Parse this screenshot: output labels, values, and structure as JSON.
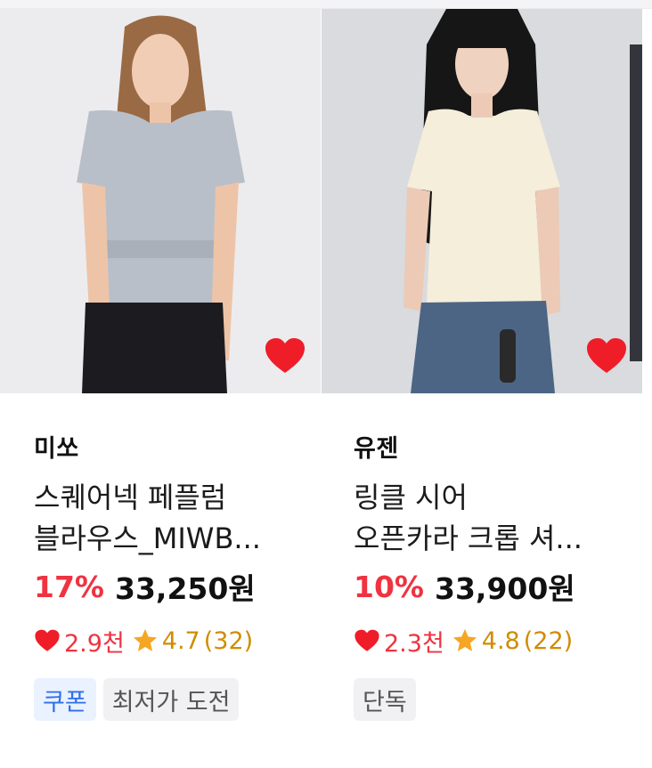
{
  "products": [
    {
      "brand": "미쏘",
      "title_line1": "스퀘어넥 페플럼",
      "title_line2": "블라우스_MIWB...",
      "discount": "17%",
      "price": "33,250원",
      "likes": "2.9천",
      "rating": "4.7",
      "review_count": "(32)",
      "tags": [
        "쿠폰",
        "최저가 도전"
      ]
    },
    {
      "brand": "유젠",
      "title_line1": "링클 시어",
      "title_line2": "오픈카라 크롭 셔...",
      "discount": "10%",
      "price": "33,900원",
      "likes": "2.3천",
      "rating": "4.8",
      "review_count": "(22)",
      "tags": [
        "단독"
      ]
    }
  ],
  "colors": {
    "accent_red": "#ef3340",
    "rating_gold": "#f5a623",
    "coupon_blue": "#2f6fe8"
  },
  "icons": [
    "heart-icon",
    "star-icon"
  ]
}
